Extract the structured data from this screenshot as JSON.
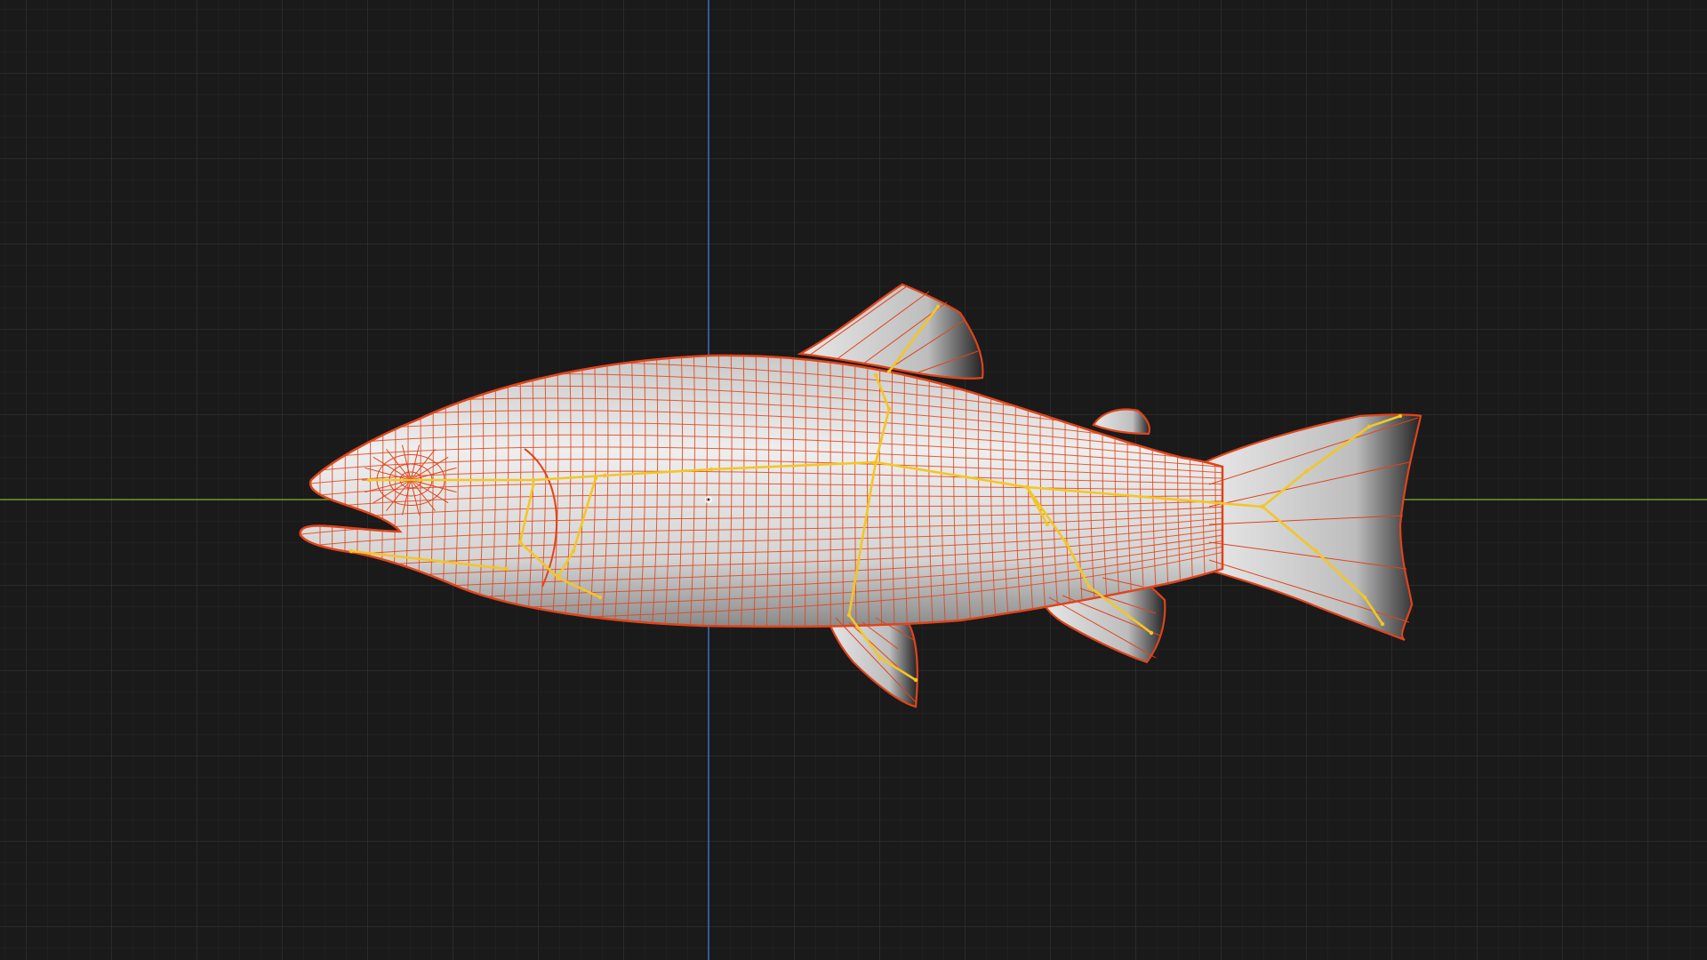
{
  "viewport": {
    "view": "orthographic-side",
    "background_color": "#1a1a1a",
    "grid_minor_color": "#262626",
    "grid_major_color": "#3a3a3a",
    "x_axis_color": "#6f9a2c",
    "z_axis_color": "#3a6fc4"
  },
  "mesh": {
    "object": "fish",
    "shading": "solid",
    "surface_color": "#d8d8d8",
    "wireframe_color": "#e0441a",
    "selected": true
  },
  "armature": {
    "bone_color": "#f3c624",
    "bone_count": 12
  },
  "origin": {
    "icon": "object-origin-icon"
  }
}
